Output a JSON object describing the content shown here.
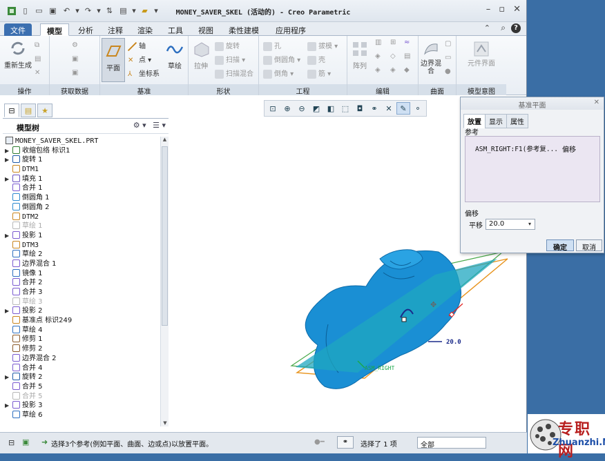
{
  "window": {
    "title": "MONEY_SAVER_SKEL (活动的) - Creo Parametric"
  },
  "tabs": [
    "文件",
    "模型",
    "分析",
    "注释",
    "渲染",
    "工具",
    "视图",
    "柔性建模",
    "应用程序"
  ],
  "ribbon": {
    "ops": {
      "label": "操作",
      "regen": "重新生成"
    },
    "getdata": {
      "label": "获取数据"
    },
    "datum": {
      "label": "基准",
      "plane": "平面",
      "axis": "轴",
      "point": "点",
      "csys": "坐标系",
      "sketch": "草绘"
    },
    "shapes": {
      "label": "形状",
      "extrude": "拉伸",
      "revolve": "旋转",
      "sweep": "扫描",
      "blend": "扫描混合"
    },
    "eng": {
      "label": "工程",
      "hole": "孔",
      "round": "倒圆角",
      "chamfer": "倒角",
      "draft": "拔模",
      "shell": "壳",
      "rib": "筋"
    },
    "edit": {
      "label": "编辑",
      "pattern": "阵列"
    },
    "surf": {
      "label": "曲面",
      "boundary": "边界混合"
    },
    "intent": {
      "label": "模型意图",
      "component": "元件界面"
    }
  },
  "panel": {
    "tree_title": "模型树",
    "root": "MONEY_SAVER_SKEL.PRT",
    "items": [
      {
        "label": "收缩包络 标识1",
        "exp": true,
        "dim": false,
        "color": "#2e7d32"
      },
      {
        "label": "旋转 1",
        "exp": true,
        "dim": false,
        "color": "#1e5aa8"
      },
      {
        "label": "DTM1",
        "exp": false,
        "dim": false,
        "color": "#c9861e"
      },
      {
        "label": "填充 1",
        "exp": true,
        "dim": false,
        "color": "#6a52c2"
      },
      {
        "label": "合并 1",
        "exp": false,
        "dim": false,
        "color": "#7b5bd0"
      },
      {
        "label": "倒圆角 1",
        "exp": false,
        "dim": false,
        "color": "#2d8ad0"
      },
      {
        "label": "倒圆角 2",
        "exp": false,
        "dim": false,
        "color": "#2d8ad0"
      },
      {
        "label": "DTM2",
        "exp": false,
        "dim": false,
        "color": "#c9861e"
      },
      {
        "label": "草绘 1",
        "exp": false,
        "dim": true,
        "color": "#b8b8b8"
      },
      {
        "label": "投影 1",
        "exp": true,
        "dim": false,
        "color": "#7b5bd0"
      },
      {
        "label": "DTM3",
        "exp": false,
        "dim": false,
        "color": "#c9861e"
      },
      {
        "label": "草绘 2",
        "exp": false,
        "dim": false,
        "color": "#2d6fc0"
      },
      {
        "label": "边界混合 1",
        "exp": false,
        "dim": false,
        "color": "#7b5bd0"
      },
      {
        "label": "镜像 1",
        "exp": false,
        "dim": false,
        "color": "#2d6fc0"
      },
      {
        "label": "合并 2",
        "exp": false,
        "dim": false,
        "color": "#7b5bd0"
      },
      {
        "label": "合并 3",
        "exp": false,
        "dim": false,
        "color": "#7b5bd0"
      },
      {
        "label": "草绘 3",
        "exp": false,
        "dim": true,
        "color": "#b8b8b8"
      },
      {
        "label": "投影 2",
        "exp": true,
        "dim": false,
        "color": "#7b5bd0"
      },
      {
        "label": "基准点 标识249",
        "exp": false,
        "dim": false,
        "color": "#c9861e"
      },
      {
        "label": "草绘 4",
        "exp": false,
        "dim": false,
        "color": "#2d6fc0"
      },
      {
        "label": "修剪 1",
        "exp": false,
        "dim": false,
        "color": "#8a5a2a"
      },
      {
        "label": "修剪 2",
        "exp": false,
        "dim": false,
        "color": "#8a5a2a"
      },
      {
        "label": "边界混合 2",
        "exp": false,
        "dim": false,
        "color": "#7b5bd0"
      },
      {
        "label": "合并 4",
        "exp": false,
        "dim": false,
        "color": "#7b5bd0"
      },
      {
        "label": "旋转 2",
        "exp": true,
        "dim": false,
        "color": "#1e5aa8"
      },
      {
        "label": "合并 5",
        "exp": false,
        "dim": false,
        "color": "#7b5bd0"
      },
      {
        "label": "合并 5",
        "exp": false,
        "dim": true,
        "color": "#b8b8b8"
      },
      {
        "label": "投影 3",
        "exp": true,
        "dim": false,
        "color": "#7b5bd0"
      },
      {
        "label": "草绘 6",
        "exp": false,
        "dim": false,
        "color": "#2d6fc0"
      }
    ]
  },
  "graphics": {
    "dim_value": "20.0",
    "plane_label": "ASM_RIGHT"
  },
  "dialog": {
    "title": "基准平面",
    "tabs": [
      "放置",
      "显示",
      "属性"
    ],
    "ref_label": "参考",
    "ref_item": "ASM_RIGHT:F1(参考复...",
    "ref_type": "偏移",
    "offset_label": "偏移",
    "translate_label": "平移",
    "offset_value": "20.0",
    "ok": "确定",
    "cancel": "取消"
  },
  "status": {
    "message": "选择3个参考(例如平面、曲面、边或点)以放置平面。",
    "selected": "选择了 1 项",
    "filter": "全部"
  },
  "watermark": {
    "cn": "专职网",
    "url": "Zhuanzhi.Net"
  }
}
